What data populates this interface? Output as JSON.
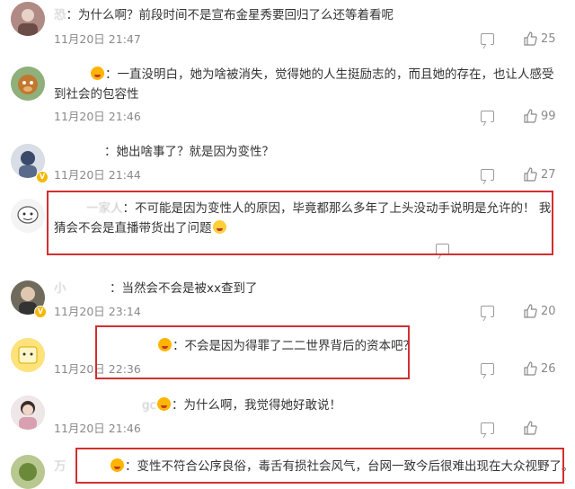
{
  "comments": [
    {
      "user": "恐",
      "text": "：为什么啊？前段时间不是宣布金星秀要回归了么还等着看呢",
      "time": "11月20日 21:47",
      "likes": "25"
    },
    {
      "user": "",
      "text": "：一直没明白，她为啥被消失，觉得她的人生挺励志的，而且她的存在，也让人感受到社会的包容性",
      "time": "11月20日 21:46",
      "likes": "99"
    },
    {
      "user": "",
      "text": "：她出啥事了？就是因为变性？",
      "time": "11月20日 21:44",
      "likes": "27"
    },
    {
      "user": "一家人",
      "text": "：不可能是因为变性人的原因，毕竟都那么多年了上头没动手说明是允许的！ 我猜会不会是直播带货出了问题",
      "time": "",
      "likes": ""
    },
    {
      "user": "小",
      "text": "：当然会不会是被xx查到了",
      "time": "11月20日 23:14",
      "likes": "20"
    },
    {
      "user": "",
      "text": "：不会是因为得罪了二二世界背后的资本吧？",
      "time": "11月20日 22:36",
      "likes": "26"
    },
    {
      "user": "gc",
      "text": "：为什么啊，我觉得她好敢说！",
      "time": "11月20日 21:46",
      "likes": ""
    },
    {
      "user": "万",
      "text": "：变性不符合公序良俗，毒舌有损社会风气，台网一致今后很难出现在大众视野了。",
      "time": "",
      "likes": ""
    }
  ],
  "colors": {
    "highlight_box": "#d32f2f",
    "badge": "#f5b800",
    "username": "#c8c8c8",
    "meta": "#8a8a8a"
  },
  "icons": {
    "reply": "reply-icon",
    "like": "thumbs-up-icon",
    "emoji": "face-emoji-icon"
  }
}
